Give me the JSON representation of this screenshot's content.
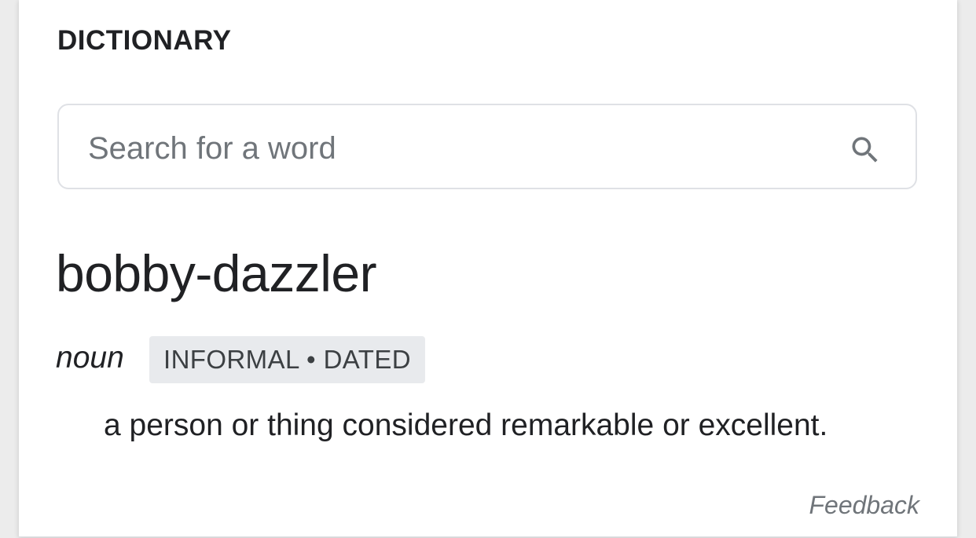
{
  "dictionary": {
    "section_title": "DICTIONARY",
    "search": {
      "placeholder": "Search for a word",
      "icon": "search-icon"
    },
    "entry": {
      "word": "bobby-dazzler",
      "part_of_speech": "noun",
      "labels": "INFORMAL • DATED",
      "definition": "a person or thing considered remarkable or excellent."
    },
    "feedback_label": "Feedback"
  },
  "colors": {
    "text_primary": "#202124",
    "text_secondary": "#70757a",
    "badge_bg": "#e8eaed",
    "border": "#dfe1e5"
  }
}
